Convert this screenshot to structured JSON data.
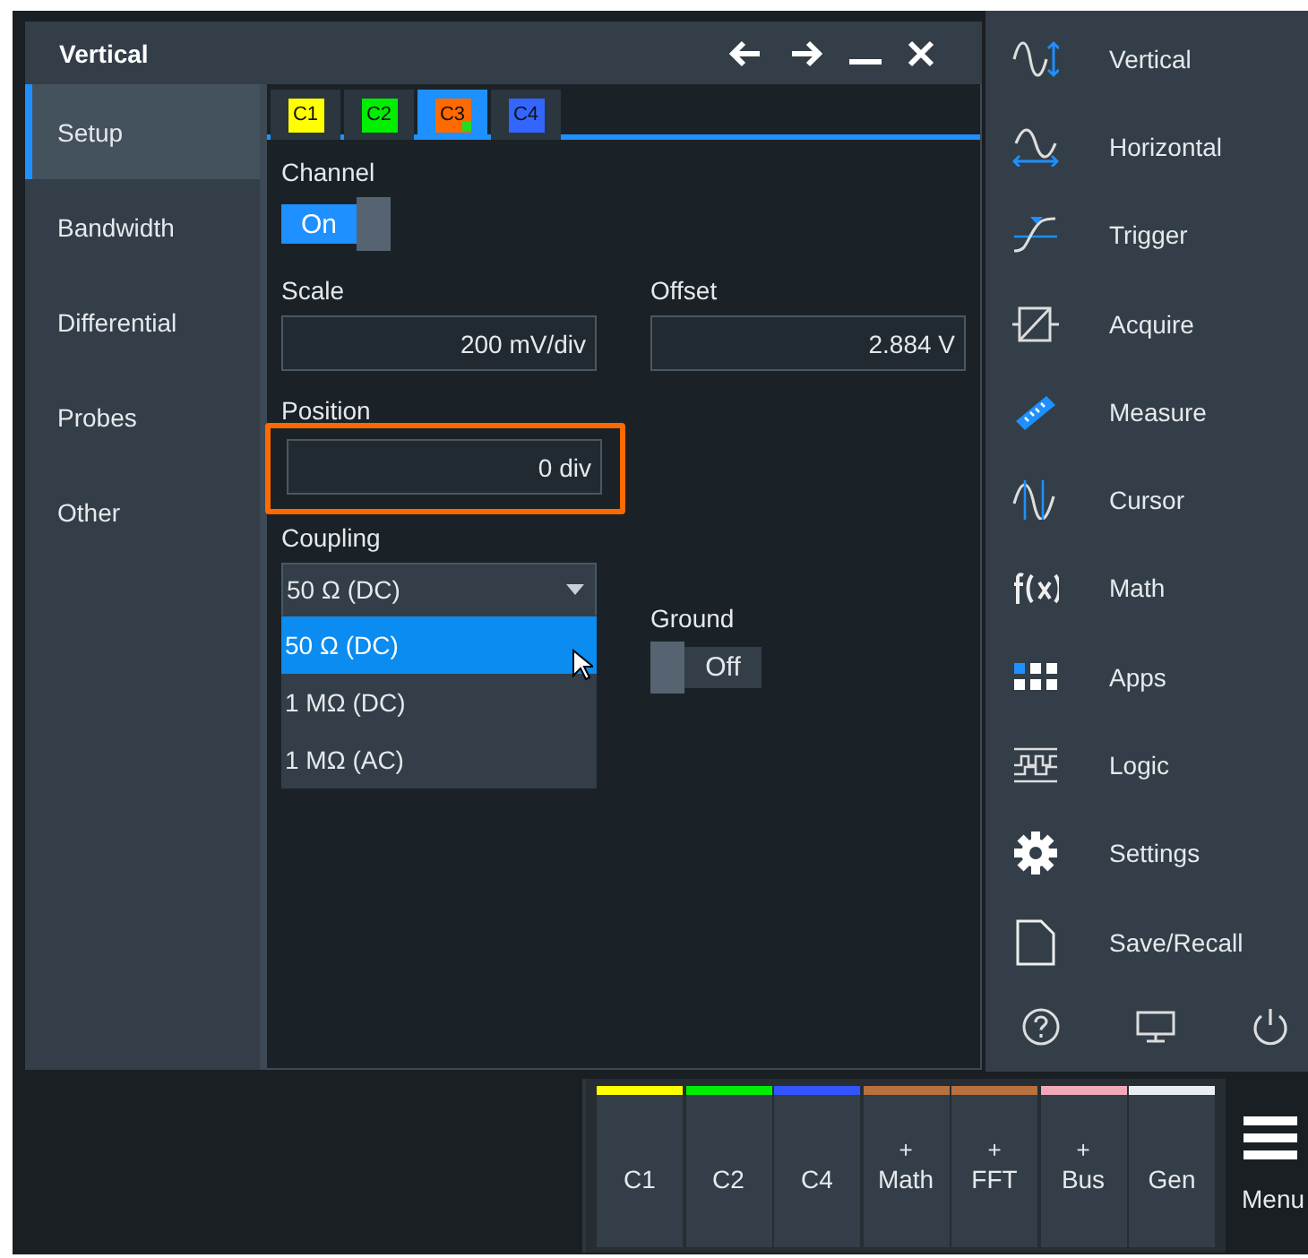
{
  "window": {
    "title": "Vertical"
  },
  "nav": [
    {
      "label": "Setup",
      "selected": true
    },
    {
      "label": "Bandwidth",
      "selected": false
    },
    {
      "label": "Differential",
      "selected": false
    },
    {
      "label": "Probes",
      "selected": false
    },
    {
      "label": "Other",
      "selected": false
    }
  ],
  "channel_tabs": [
    {
      "label": "C1",
      "color": "#ffff00",
      "selected": false,
      "indicator": false
    },
    {
      "label": "C2",
      "color": "#00ee00",
      "selected": false,
      "indicator": false
    },
    {
      "label": "C3",
      "color": "#ff6a00",
      "selected": true,
      "indicator": true
    },
    {
      "label": "C4",
      "color": "#3366ff",
      "selected": false,
      "indicator": false
    }
  ],
  "channel": {
    "label": "Channel",
    "on": true,
    "text": "On"
  },
  "scale": {
    "label": "Scale",
    "value": "200 mV/div"
  },
  "offset": {
    "label": "Offset",
    "value": "2.884 V"
  },
  "position": {
    "label": "Position",
    "value": "0 div",
    "highlighted": true
  },
  "coupling": {
    "label": "Coupling",
    "value": "50 Ω (DC)",
    "expanded": true,
    "options": [
      {
        "label": "50 Ω (DC)",
        "selected": true
      },
      {
        "label": "1 MΩ (DC)",
        "selected": false
      },
      {
        "label": "1 MΩ (AC)",
        "selected": false
      }
    ]
  },
  "ground": {
    "label": "Ground",
    "on": false,
    "text": "Off"
  },
  "menu": [
    {
      "label": "Vertical"
    },
    {
      "label": "Horizontal"
    },
    {
      "label": "Trigger"
    },
    {
      "label": "Acquire"
    },
    {
      "label": "Measure"
    },
    {
      "label": "Cursor"
    },
    {
      "label": "Math"
    },
    {
      "label": "Apps"
    },
    {
      "label": "Logic"
    },
    {
      "label": "Settings"
    },
    {
      "label": "Save/Recall"
    }
  ],
  "signal_bar": [
    {
      "label": "C1",
      "color": "#ffff00"
    },
    {
      "label": "C2",
      "color": "#00ee00"
    },
    {
      "label": "C4",
      "color": "#3355ff"
    },
    {
      "top": "+",
      "label": "Math",
      "color": "#b8703f"
    },
    {
      "top": "+",
      "label": "FFT",
      "color": "#b8703f"
    },
    {
      "top": "+",
      "label": "Bus",
      "color": "#f0a8b8"
    },
    {
      "label": "Gen",
      "color": "#e8eef4"
    }
  ],
  "menu_button": {
    "label": "Menu"
  }
}
